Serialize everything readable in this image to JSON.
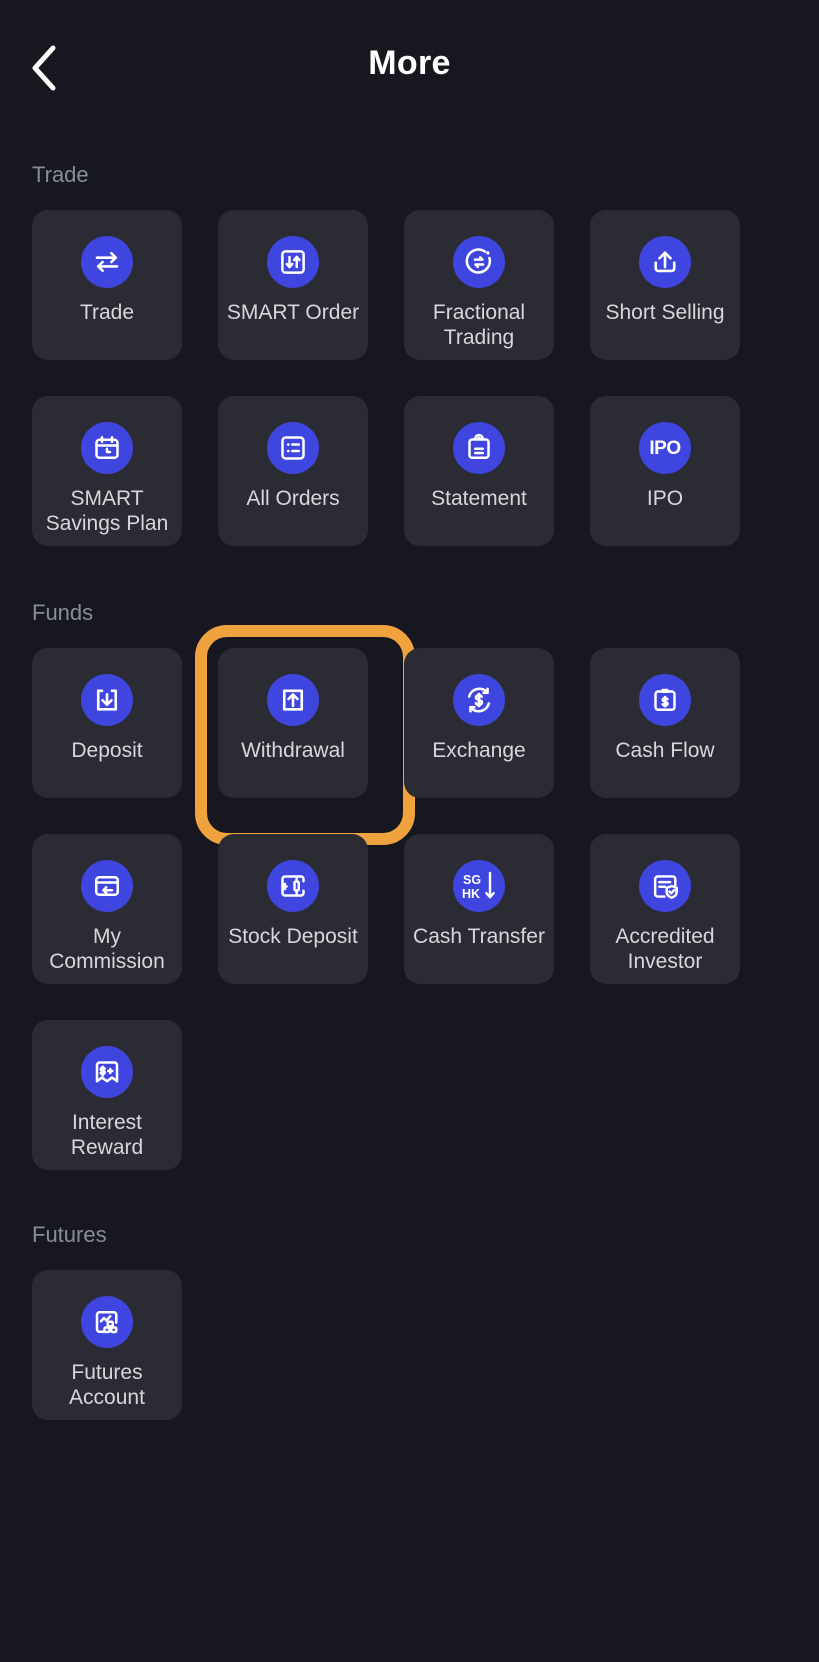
{
  "header": {
    "title": "More",
    "back_icon": "chevron-left-icon"
  },
  "theme": {
    "background": "#17181f",
    "tile_background": "#2b2c33",
    "accent_blue": "#3f45df",
    "highlight_orange": "#efa23e",
    "label_color": "#d6d7dc",
    "section_title_color": "#8a8c94"
  },
  "sections": [
    {
      "title": "Trade",
      "items": [
        {
          "label": "Trade",
          "icon": "transfer-arrows-icon"
        },
        {
          "label": "SMART Order",
          "icon": "smart-order-icon"
        },
        {
          "label": "Fractional Trading",
          "icon": "fractional-circle-icon"
        },
        {
          "label": "Short Selling",
          "icon": "upload-tray-icon"
        },
        {
          "label": "SMART Savings Plan",
          "icon": "calendar-clock-icon"
        },
        {
          "label": "All Orders",
          "icon": "list-icon"
        },
        {
          "label": "Statement",
          "icon": "clipboard-lines-icon"
        },
        {
          "label": "IPO",
          "icon": "ipo-text-icon",
          "icon_text": "IPO"
        }
      ]
    },
    {
      "title": "Funds",
      "items": [
        {
          "label": "Deposit",
          "icon": "download-tray-icon"
        },
        {
          "label": "Withdrawal",
          "icon": "upload-box-icon",
          "highlighted": true
        },
        {
          "label": "Exchange",
          "icon": "currency-exchange-icon"
        },
        {
          "label": "Cash Flow",
          "icon": "clipboard-dollar-icon"
        },
        {
          "label": "My Commission",
          "icon": "card-return-icon"
        },
        {
          "label": "Stock Deposit",
          "icon": "stock-transfer-icon"
        },
        {
          "label": "Cash Transfer",
          "icon": "sg-hk-arrow-icon",
          "icon_text_top": "SG",
          "icon_text_bottom": "HK"
        },
        {
          "label": "Accredited Investor",
          "icon": "document-shield-check-icon"
        },
        {
          "label": "Interest Reward",
          "icon": "banner-dollar-plus-icon"
        }
      ]
    },
    {
      "title": "Futures",
      "items": [
        {
          "label": "Futures Account",
          "icon": "chart-blocks-icon"
        }
      ]
    }
  ]
}
